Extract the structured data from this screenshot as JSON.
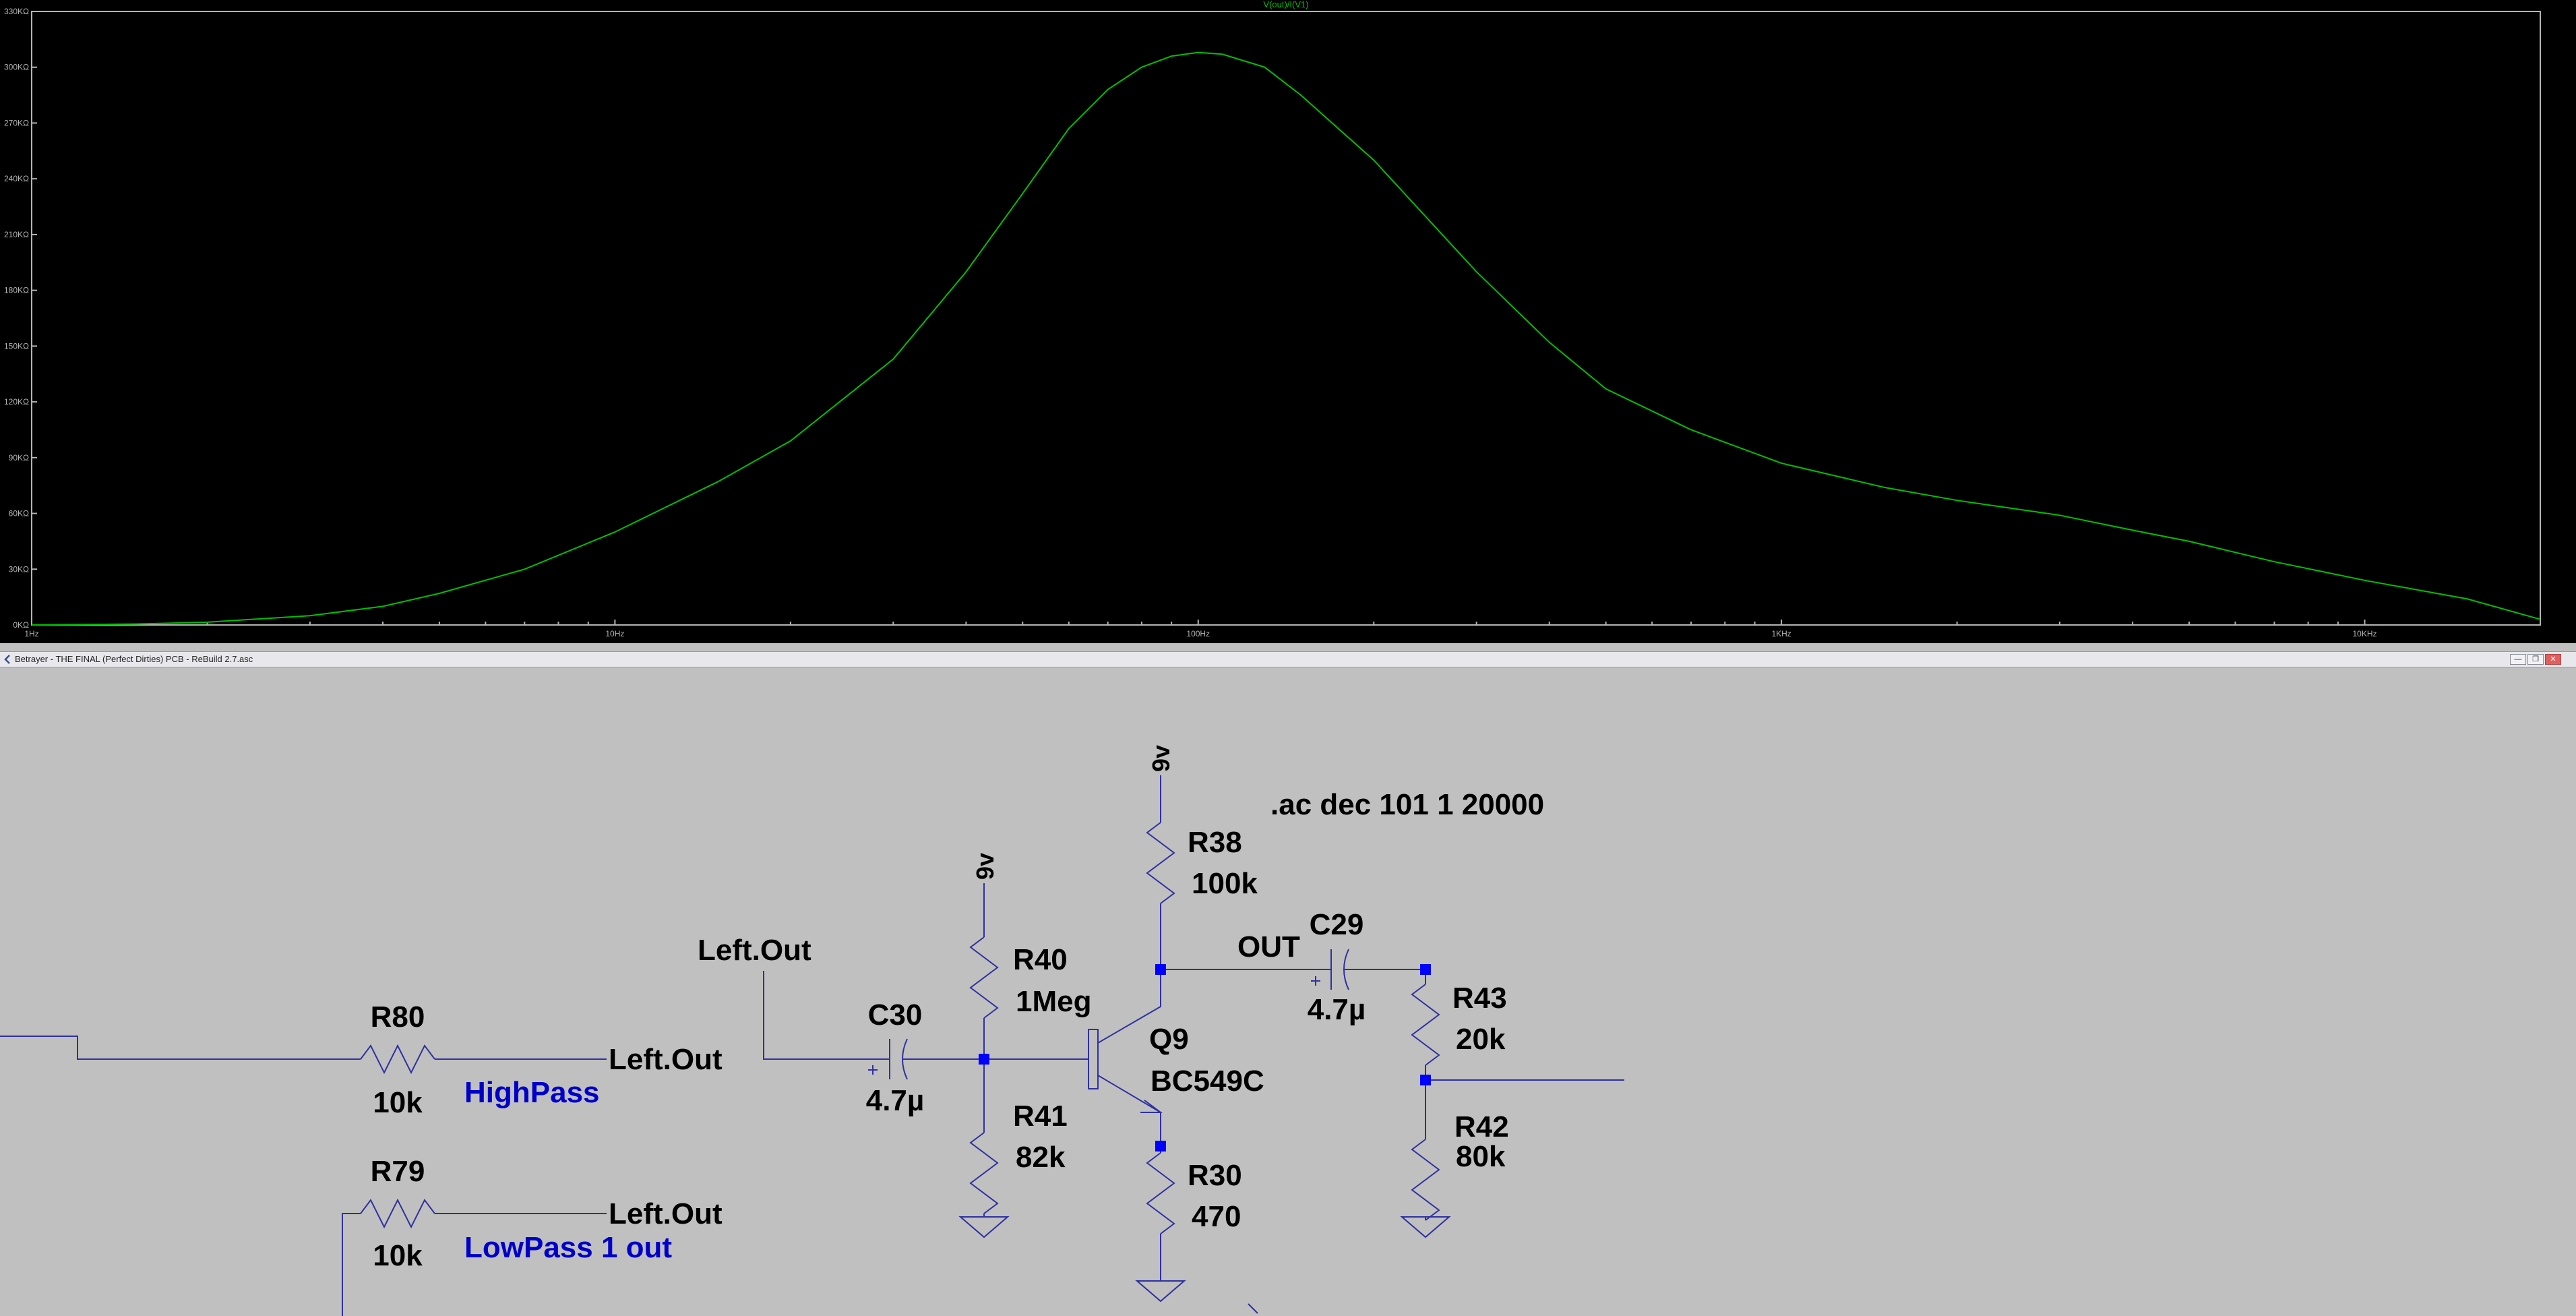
{
  "plot": {
    "trace_label": "V(out)/I(V1)",
    "trace_color": "#00c000",
    "axis_color": "#b4b4b4",
    "background": "#000000",
    "y_ticks": [
      "0KΩ",
      "30KΩ",
      "60KΩ",
      "90KΩ",
      "120KΩ",
      "150KΩ",
      "180KΩ",
      "210KΩ",
      "240KΩ",
      "270KΩ",
      "300KΩ",
      "330KΩ"
    ],
    "x_ticks": [
      "1Hz",
      "10Hz",
      "100Hz",
      "1KHz",
      "10KHz"
    ]
  },
  "chart_data": {
    "type": "line",
    "title": "V(out)/I(V1)",
    "xscale": "log",
    "xlim": [
      1,
      20000
    ],
    "ylim": [
      0,
      330
    ],
    "yunit": "KΩ",
    "grid": false,
    "series": [
      {
        "name": "V(out)/I(V1)",
        "x": [
          1,
          1.5,
          2,
          3,
          4,
          5,
          7,
          10,
          15,
          20,
          30,
          40,
          50,
          60,
          70,
          80,
          90,
          100,
          110,
          130,
          150,
          200,
          300,
          400,
          500,
          700,
          1000,
          1500,
          2000,
          3000,
          4000,
          5000,
          7000,
          10000,
          15000,
          20000
        ],
        "y": [
          0,
          0.5,
          1.5,
          5,
          10,
          17,
          30,
          50,
          77,
          99,
          143,
          190,
          232,
          267,
          288,
          300,
          306,
          308,
          307,
          300,
          285,
          250,
          190,
          152,
          127,
          105,
          87,
          74,
          67,
          59,
          51,
          45,
          34,
          24,
          14,
          3
        ]
      }
    ]
  },
  "window": {
    "title": "Betrayer - THE FINAL (Perfect Dirties) PCB - ReBuild 2.7.asc",
    "minimize": "—",
    "restore": "❐",
    "close": "✕"
  },
  "schematic": {
    "wire_color": "#3030a0",
    "node_color": "#0000ff",
    "label_color": "#000000",
    "net_label_color": "#0000c8",
    "directive": ".ac dec 101 1 20000",
    "supply_r38": "9v",
    "supply_r40": "9v",
    "r80": {
      "name": "R80",
      "value": "10k"
    },
    "r79": {
      "name": "R79",
      "value": "10k"
    },
    "r40": {
      "name": "R40",
      "value": "1Meg"
    },
    "r41": {
      "name": "R41",
      "value": "82k"
    },
    "r38": {
      "name": "R38",
      "value": "100k"
    },
    "r30": {
      "name": "R30",
      "value": "470"
    },
    "r43": {
      "name": "R43",
      "value": "20k"
    },
    "r42": {
      "name": "R42",
      "value": "80k"
    },
    "c30": {
      "name": "C30",
      "value": "4.7µ"
    },
    "c29": {
      "name": "C29",
      "value": "4.7µ"
    },
    "q9": {
      "name": "Q9",
      "value": "BC549C"
    },
    "net_leftout_1": "Left.Out",
    "net_leftout_2": "Left.Out",
    "net_leftout_3": "Left.Out",
    "net_out": "OUT",
    "net_highpass": "HighPass",
    "net_lowpass": "LowPass 1 out"
  }
}
